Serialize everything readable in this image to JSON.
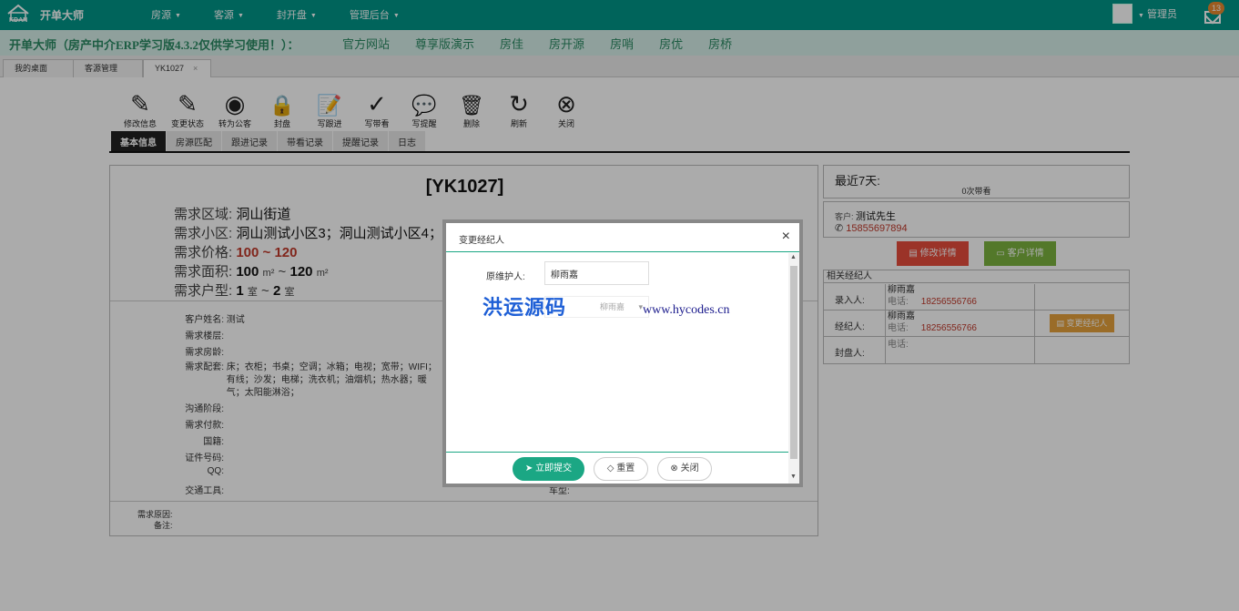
{
  "app": {
    "name": "开单大师",
    "logo_mark": "KDAN"
  },
  "nav": [
    {
      "label": "房源"
    },
    {
      "label": "客源"
    },
    {
      "label": "封开盘"
    },
    {
      "label": "管理后台"
    }
  ],
  "user": {
    "name": "管理员",
    "notifications": "13"
  },
  "marquee": {
    "message": "开单大师（房产中介ERP学习版4.3.2仅供学习使用！）：",
    "links": [
      "官方网站",
      "尊享版演示",
      "房佳",
      "房开源",
      "房哨",
      "房优",
      "房桥"
    ]
  },
  "tabs": [
    {
      "label": "我的桌面"
    },
    {
      "label": "客源管理"
    },
    {
      "label": "YK1027"
    }
  ],
  "toolbar": [
    {
      "label": "修改信息",
      "icon": "pencil-icon",
      "glyph": "✎"
    },
    {
      "label": "变更状态",
      "icon": "pencil-icon",
      "glyph": "✎"
    },
    {
      "label": "转为公客",
      "icon": "eye-icon",
      "glyph": "◉"
    },
    {
      "label": "封盘",
      "icon": "lock-icon",
      "glyph": "🔒"
    },
    {
      "label": "写跟进",
      "icon": "note-icon",
      "glyph": "📝"
    },
    {
      "label": "写带看",
      "icon": "check-circle-icon",
      "glyph": "✓"
    },
    {
      "label": "写提醒",
      "icon": "chat-icon",
      "glyph": "💬"
    },
    {
      "label": "删除",
      "icon": "trash-icon",
      "glyph": "🗑"
    },
    {
      "label": "刷新",
      "icon": "refresh-icon",
      "glyph": "↻"
    },
    {
      "label": "关闭",
      "icon": "close-circle-icon",
      "glyph": "⊗"
    }
  ],
  "subtabs": [
    {
      "label": "基本信息"
    },
    {
      "label": "房源匹配"
    },
    {
      "label": "跟进记录"
    },
    {
      "label": "带看记录"
    },
    {
      "label": "提醒记录"
    },
    {
      "label": "日志"
    }
  ],
  "detail": {
    "title": "[YK1027]",
    "area_label": "需求区域:",
    "area_value": "洞山街道",
    "community_label": "需求小区:",
    "community_value": "洞山测试小区3；洞山测试小区4；洞山测试小区6",
    "price_label": "需求价格:",
    "price_value": "100 ~ 120",
    "size_label": "需求面积:",
    "size_min": "100",
    "size_max": "120",
    "size_unit": "m²",
    "size_sep": "~",
    "layout_label": "需求户型:",
    "layout_min": "1",
    "layout_max": "2",
    "layout_unit": "室",
    "layout_sep": "~"
  },
  "fields": [
    {
      "label": "客户姓名:",
      "value": "测试"
    },
    {
      "label": "需求楼层:",
      "value": ""
    },
    {
      "label": "需求房龄:",
      "value": ""
    },
    {
      "label": "需求配套:",
      "value": "床；衣柜；书桌；空调；冰箱；电视；宽带；WIFI；"
    },
    {
      "label": "",
      "value": "有线；沙发；电梯；洗衣机；油烟机；热水器；暖"
    },
    {
      "label": "",
      "value": "气；太阳能淋浴；"
    },
    {
      "label": "沟通阶段:",
      "value": ""
    },
    {
      "label": "需求付款:",
      "value": ""
    },
    {
      "label": "国籍:",
      "value": ""
    },
    {
      "label": "证件号码:",
      "value": ""
    },
    {
      "label": "QQ:",
      "value": ""
    },
    {
      "label": "交通工具:",
      "value": ""
    }
  ],
  "car_label": "车型:",
  "bottom_fields": [
    {
      "label": "需求原因:"
    },
    {
      "label": "备注:"
    }
  ],
  "stats": {
    "title": "最近7天:",
    "value": "0次带看"
  },
  "customer": {
    "label": "客户:",
    "name": "测试先生",
    "phone": "15855697894"
  },
  "buttons": {
    "edit": "修改详情",
    "detail": "客户详情"
  },
  "agents": {
    "header": "相关经纪人",
    "rows": [
      {
        "label": "录入人:",
        "name": "柳雨嘉",
        "phone_label": "电话:",
        "phone": "18256556766"
      },
      {
        "label": "经纪人:",
        "name": "柳雨嘉",
        "phone_label": "电话:",
        "phone": "18256556766",
        "action": "变更经纪人"
      },
      {
        "label": "封盘人:",
        "name": "",
        "phone_label": "电话:",
        "phone": ""
      }
    ]
  },
  "modal": {
    "title": "变更经纪人",
    "original_label": "原维护人:",
    "original_value": "柳雨嘉",
    "new_agent_value": "柳雨嘉",
    "watermark": "洪运源码",
    "watermark_url": "www.hycodes.cn",
    "submit": "立即提交",
    "reset": "重置",
    "close": "关闭"
  }
}
